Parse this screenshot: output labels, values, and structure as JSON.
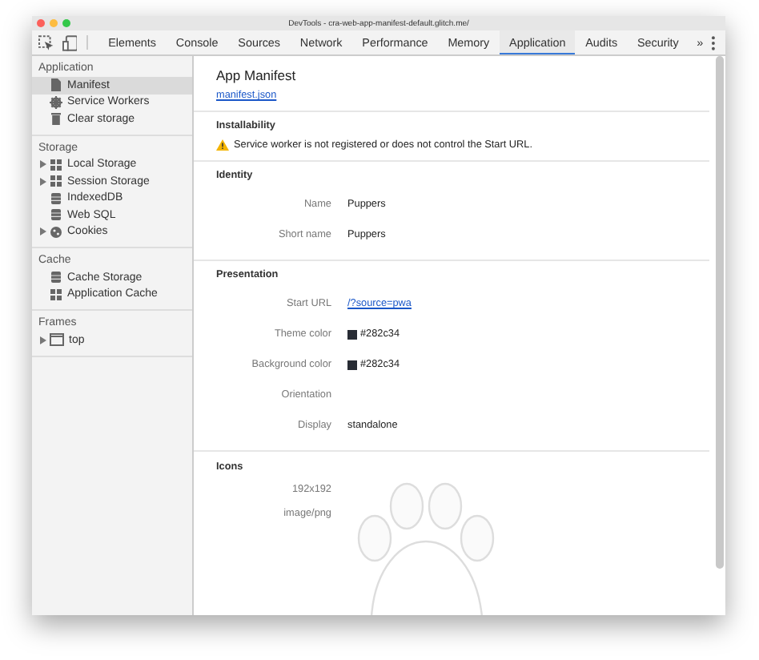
{
  "window": {
    "title": "DevTools - cra-web-app-manifest-default.glitch.me/"
  },
  "tabs": [
    {
      "label": "Elements",
      "selected": false
    },
    {
      "label": "Console",
      "selected": false
    },
    {
      "label": "Sources",
      "selected": false
    },
    {
      "label": "Network",
      "selected": false
    },
    {
      "label": "Performance",
      "selected": false
    },
    {
      "label": "Memory",
      "selected": false
    },
    {
      "label": "Application",
      "selected": true
    },
    {
      "label": "Audits",
      "selected": false
    },
    {
      "label": "Security",
      "selected": false
    }
  ],
  "more_tabs": "»",
  "sidebar": {
    "sections": [
      {
        "title": "Application",
        "items": [
          {
            "label": "Manifest",
            "kind": "file",
            "expandable": false,
            "selected": true
          },
          {
            "label": "Service Workers",
            "kind": "gear",
            "expandable": false,
            "selected": false
          },
          {
            "label": "Clear storage",
            "kind": "trash",
            "expandable": false,
            "selected": false
          }
        ]
      },
      {
        "title": "Storage",
        "items": [
          {
            "label": "Local Storage",
            "kind": "grid",
            "expandable": true,
            "selected": false
          },
          {
            "label": "Session Storage",
            "kind": "grid",
            "expandable": true,
            "selected": false
          },
          {
            "label": "IndexedDB",
            "kind": "db",
            "expandable": false,
            "selected": false
          },
          {
            "label": "Web SQL",
            "kind": "db",
            "expandable": false,
            "selected": false
          },
          {
            "label": "Cookies",
            "kind": "cookie",
            "expandable": true,
            "selected": false
          }
        ]
      },
      {
        "title": "Cache",
        "items": [
          {
            "label": "Cache Storage",
            "kind": "db",
            "expandable": false,
            "selected": false
          },
          {
            "label": "Application Cache",
            "kind": "grid",
            "expandable": false,
            "selected": false
          }
        ]
      },
      {
        "title": "Frames",
        "items": [
          {
            "label": "top",
            "kind": "frame",
            "expandable": true,
            "selected": false
          }
        ]
      }
    ]
  },
  "manifest": {
    "title": "App Manifest",
    "link": "manifest.json",
    "installability": {
      "title": "Installability",
      "warning": "Service worker is not registered or does not control the Start URL."
    },
    "identity": {
      "title": "Identity",
      "rows": [
        {
          "label": "Name",
          "value": "Puppers",
          "kind": "text"
        },
        {
          "label": "Short name",
          "value": "Puppers",
          "kind": "text"
        }
      ]
    },
    "presentation": {
      "title": "Presentation",
      "rows": [
        {
          "label": "Start URL",
          "value": "/?source=pwa",
          "kind": "link"
        },
        {
          "label": "Theme color",
          "value": "#282c34",
          "kind": "color"
        },
        {
          "label": "Background color",
          "value": "#282c34",
          "kind": "color"
        },
        {
          "label": "Orientation",
          "kind": "text"
        },
        {
          "label": "Display",
          "value": "standalone",
          "kind": "text"
        }
      ]
    },
    "icons": {
      "title": "Icons",
      "size": "192x192",
      "type": "image/png"
    }
  }
}
